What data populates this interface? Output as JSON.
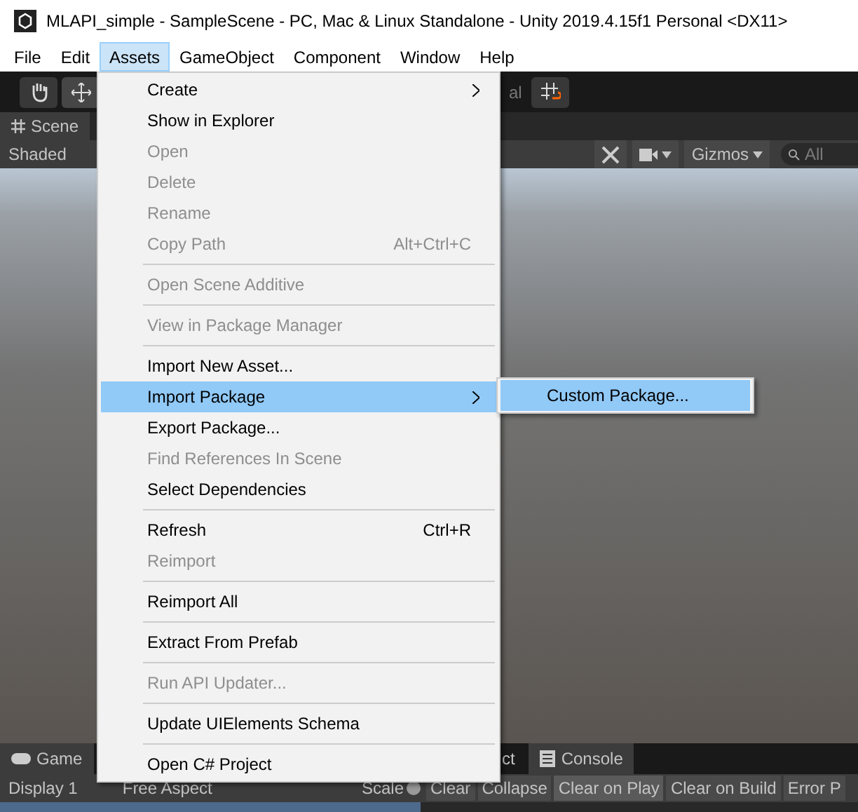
{
  "window": {
    "title": "MLAPI_simple - SampleScene - PC, Mac & Linux Standalone - Unity 2019.4.15f1 Personal <DX11>"
  },
  "menu_bar": [
    {
      "label": "File",
      "selected": false
    },
    {
      "label": "Edit",
      "selected": false
    },
    {
      "label": "Assets",
      "selected": true
    },
    {
      "label": "GameObject",
      "selected": false
    },
    {
      "label": "Component",
      "selected": false
    },
    {
      "label": "Window",
      "selected": false
    },
    {
      "label": "Help",
      "selected": false
    }
  ],
  "toolbar": {
    "partial_label": "al"
  },
  "scene": {
    "tab": "Scene",
    "shading": "Shaded",
    "gizmos": "Gizmos",
    "search": {
      "placeholder": "All"
    }
  },
  "assets_menu": [
    {
      "kind": "item",
      "label": "Create",
      "submenu": true,
      "disabled": false,
      "selected": false
    },
    {
      "kind": "item",
      "label": "Show in Explorer",
      "disabled": false,
      "selected": false
    },
    {
      "kind": "item",
      "label": "Open",
      "disabled": true,
      "selected": false
    },
    {
      "kind": "item",
      "label": "Delete",
      "disabled": true,
      "selected": false
    },
    {
      "kind": "item",
      "label": "Rename",
      "disabled": true,
      "selected": false
    },
    {
      "kind": "item",
      "label": "Copy Path",
      "shortcut": "Alt+Ctrl+C",
      "disabled": true,
      "selected": false
    },
    {
      "kind": "separator"
    },
    {
      "kind": "item",
      "label": "Open Scene Additive",
      "disabled": true,
      "selected": false
    },
    {
      "kind": "separator"
    },
    {
      "kind": "item",
      "label": "View in Package Manager",
      "disabled": true,
      "selected": false
    },
    {
      "kind": "separator"
    },
    {
      "kind": "item",
      "label": "Import New Asset...",
      "disabled": false,
      "selected": false
    },
    {
      "kind": "item",
      "label": "Import Package",
      "submenu": true,
      "disabled": false,
      "selected": true
    },
    {
      "kind": "item",
      "label": "Export Package...",
      "disabled": false,
      "selected": false
    },
    {
      "kind": "item",
      "label": "Find References In Scene",
      "disabled": true,
      "selected": false
    },
    {
      "kind": "item",
      "label": "Select Dependencies",
      "disabled": false,
      "selected": false
    },
    {
      "kind": "separator"
    },
    {
      "kind": "item",
      "label": "Refresh",
      "shortcut": "Ctrl+R",
      "disabled": false,
      "selected": false
    },
    {
      "kind": "item",
      "label": "Reimport",
      "disabled": true,
      "selected": false
    },
    {
      "kind": "separator"
    },
    {
      "kind": "item",
      "label": "Reimport All",
      "disabled": false,
      "selected": false
    },
    {
      "kind": "separator"
    },
    {
      "kind": "item",
      "label": "Extract From Prefab",
      "disabled": false,
      "selected": false
    },
    {
      "kind": "separator"
    },
    {
      "kind": "item",
      "label": "Run API Updater...",
      "disabled": true,
      "selected": false
    },
    {
      "kind": "separator"
    },
    {
      "kind": "item",
      "label": "Update UIElements Schema",
      "disabled": false,
      "selected": false
    },
    {
      "kind": "separator"
    },
    {
      "kind": "item",
      "label": "Open C# Project",
      "disabled": false,
      "selected": false
    }
  ],
  "import_package_submenu": [
    {
      "label": "Custom Package...",
      "selected": true
    }
  ],
  "game": {
    "tab": "Game",
    "display": "Display 1",
    "aspect": "Free Aspect",
    "scale": "Scale"
  },
  "console": {
    "tabs": [
      {
        "label": "ct",
        "selected": false
      },
      {
        "label": "Console",
        "selected": true
      }
    ],
    "buttons": [
      {
        "label": "Clear",
        "selected": false
      },
      {
        "label": "Collapse",
        "selected": false
      },
      {
        "label": "Clear on Play",
        "selected": true
      },
      {
        "label": "Clear on Build",
        "selected": false
      },
      {
        "label": "Error P",
        "selected": false
      }
    ]
  }
}
